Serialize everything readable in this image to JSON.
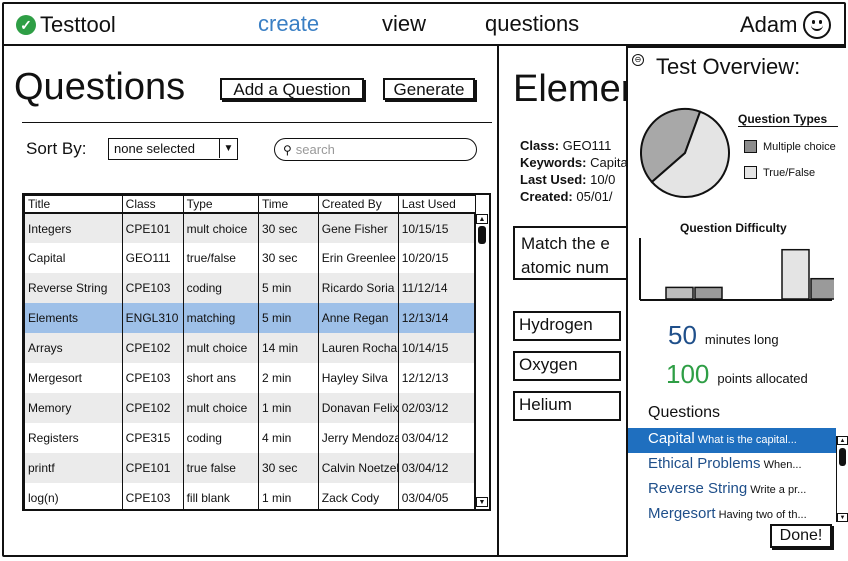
{
  "app": {
    "name": "Testtool",
    "logo_icon": "check-circle-icon"
  },
  "nav": {
    "create": "create",
    "view": "view",
    "questions": "questions"
  },
  "user": {
    "name": "Adam",
    "icon": "smiley-icon"
  },
  "questions_page": {
    "title": "Questions",
    "add_button": "Add a Question",
    "generate_button": "Generate",
    "sort_label": "Sort By:",
    "sort_value": "none selected",
    "search_placeholder": "search"
  },
  "table": {
    "headers": [
      "Title",
      "Class",
      "Type",
      "Time",
      "Created By",
      "Last Used"
    ],
    "rows": [
      [
        "Integers",
        "CPE101",
        "mult choice",
        "30 sec",
        "Gene Fisher",
        "10/15/15"
      ],
      [
        "Capital",
        "GEO111",
        "true/false",
        "30 sec",
        "Erin Greenlee",
        "10/20/15"
      ],
      [
        "Reverse String",
        "CPE103",
        "coding",
        "5 min",
        "Ricardo Soria",
        "11/12/14"
      ],
      [
        "Elements",
        "ENGL310",
        "matching",
        "5 min",
        "Anne Regan",
        "12/13/14"
      ],
      [
        "Arrays",
        "CPE102",
        "mult choice",
        "14 min",
        "Lauren Rocha",
        "10/14/15"
      ],
      [
        "Mergesort",
        "CPE103",
        "short ans",
        "2 min",
        "Hayley Silva",
        "12/12/13"
      ],
      [
        "Memory",
        "CPE102",
        "mult choice",
        "1 min",
        "Donavan Felix",
        "02/03/12"
      ],
      [
        "Registers",
        "CPE315",
        "coding",
        "4 min",
        "Jerry Mendoza",
        "03/04/12"
      ],
      [
        "printf",
        "CPE101",
        "true false",
        "30 sec",
        "Calvin Noetzel",
        "03/04/12"
      ],
      [
        "log(n)",
        "CPE103",
        "fill blank",
        "1 min",
        "Zack Cody",
        "03/04/05"
      ]
    ],
    "selected_row": 3
  },
  "detail": {
    "title": "Elements",
    "class_label": "Class:",
    "class_value": "GEO111",
    "keywords_label": "Keywords:",
    "keywords_value": "Capital",
    "last_used_label": "Last Used:",
    "last_used_value": "10/0",
    "created_label": "Created:",
    "created_value": "05/01/",
    "question_line1": "Match the e",
    "question_line2": "atomic num",
    "answers": [
      "Hydrogen",
      "Oxygen",
      "Helium"
    ]
  },
  "overview": {
    "title": "Test Overview:",
    "legend_title": "Question Types",
    "legend": [
      {
        "label": "Multiple choice",
        "color": "#8c8c8c"
      },
      {
        "label": "True/False",
        "color": "#e4e4e4"
      }
    ],
    "pie": {
      "multiple_choice_fraction": 0.42,
      "true_false_fraction": 0.58
    },
    "difficulty_title": "Question Difficulty",
    "difficulty_bars": [
      0.2,
      0.2,
      0,
      0,
      0.85,
      0.35
    ],
    "minutes": "50",
    "minutes_label": "minutes long",
    "points": "100",
    "points_label": "points allocated",
    "points_color": "#2e9e45",
    "questions_label": "Questions",
    "questions": [
      {
        "title": "Capital",
        "desc": "What is the capital..."
      },
      {
        "title": "Ethical Problems",
        "desc": "When..."
      },
      {
        "title": "Reverse String",
        "desc": "Write a pr..."
      },
      {
        "title": "Mergesort",
        "desc": "Having two of th..."
      }
    ],
    "selected_question": 0,
    "done_button": "Done!"
  }
}
